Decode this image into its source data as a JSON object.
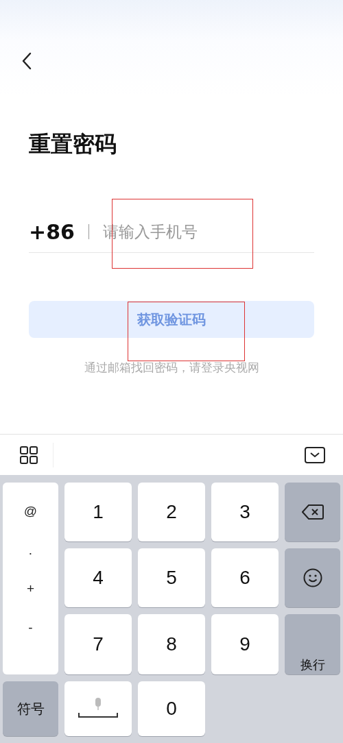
{
  "title": "重置密码",
  "phone": {
    "country_code": "+86",
    "placeholder": "请输入手机号"
  },
  "get_code_button": {
    "label": "获取验证码",
    "disabled": true
  },
  "hint": "通过邮箱找回密码，请登录央视网",
  "keyboard": {
    "keys": [
      {
        "kind": "symbols",
        "labels": [
          "@",
          ".",
          "+",
          "-"
        ]
      },
      {
        "kind": "digit",
        "label": "1"
      },
      {
        "kind": "digit",
        "label": "2"
      },
      {
        "kind": "digit",
        "label": "3"
      },
      {
        "kind": "delete"
      },
      {
        "kind": "digit",
        "label": "4"
      },
      {
        "kind": "digit",
        "label": "5"
      },
      {
        "kind": "digit",
        "label": "6"
      },
      {
        "kind": "emoji"
      },
      {
        "kind": "digit",
        "label": "7"
      },
      {
        "kind": "digit",
        "label": "8"
      },
      {
        "kind": "digit",
        "label": "9"
      },
      {
        "kind": "enter",
        "label": "换行"
      },
      {
        "kind": "switch",
        "label": "符号"
      },
      {
        "kind": "space"
      },
      {
        "kind": "digit",
        "label": "0"
      }
    ]
  }
}
